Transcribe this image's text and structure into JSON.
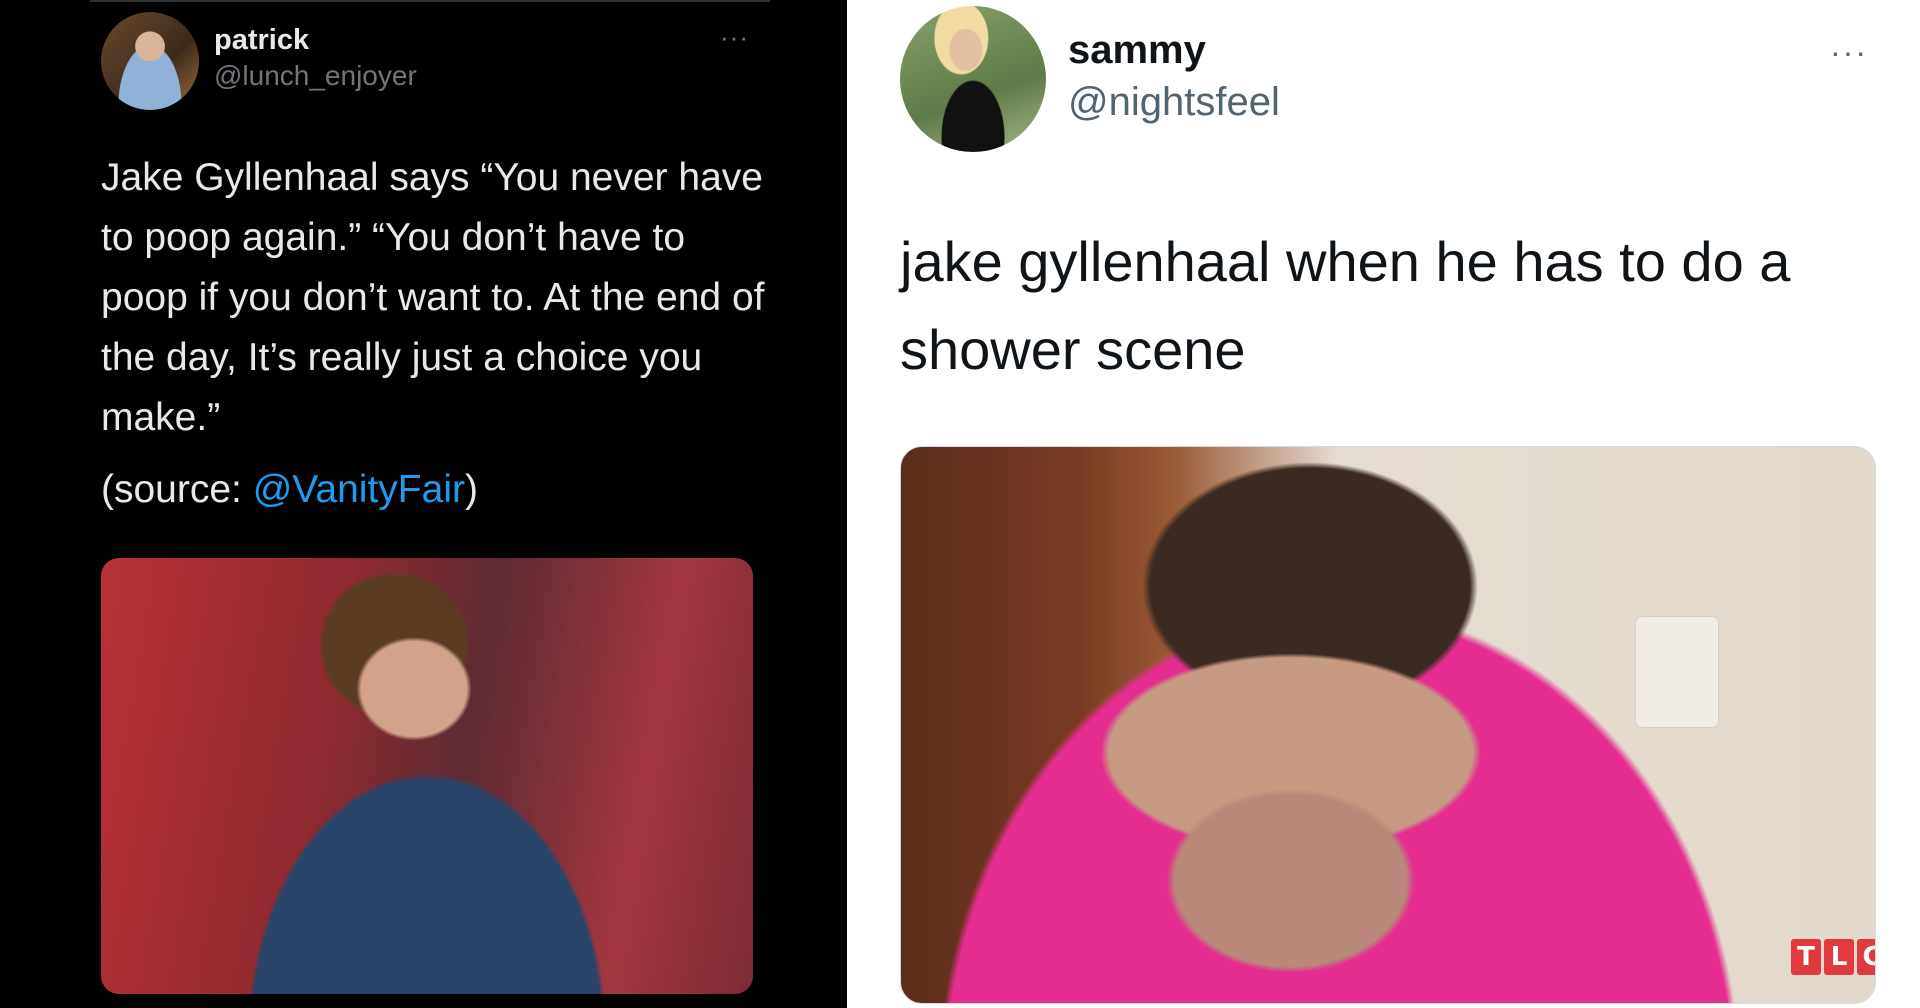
{
  "left_tweet": {
    "name": "patrick",
    "handle": "@lunch_enjoyer",
    "more": "···",
    "text": "Jake Gyllenhaal says “You never have to poop again.” “You don’t have to poop if you don’t want to. At the end of the day, It’s really just a choice you make.”",
    "source_prefix": "(source: ",
    "source_link": "@VanityFair",
    "source_suffix": ")"
  },
  "right_tweet": {
    "name": "sammy",
    "handle": "@nightsfeel",
    "more": "···",
    "text": "jake gyllenhaal when he has to do a shower scene",
    "logo_letters": [
      "T",
      "L",
      "C"
    ]
  },
  "colors": {
    "dark_bg": "#000000",
    "link": "#1d9bf0",
    "light_bg": "#ffffff",
    "tlc_red": "#e03a3e"
  },
  "icons": {
    "more": "more-options-icon"
  }
}
